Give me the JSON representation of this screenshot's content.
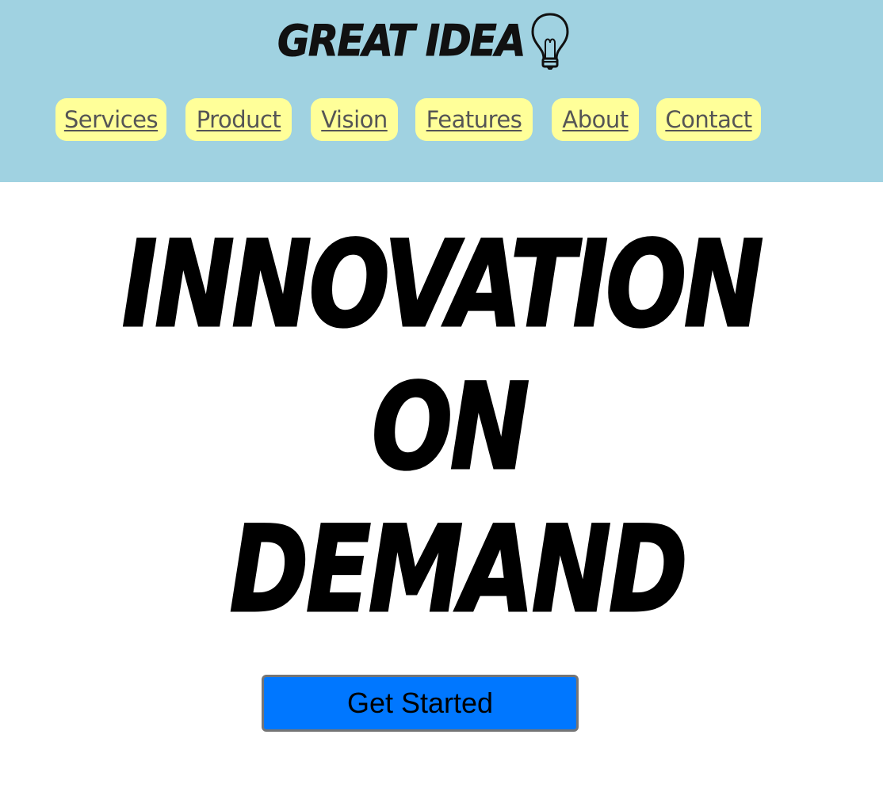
{
  "header": {
    "logo_text": "GREAT IDEA",
    "logo_icon": "lightbulb-icon",
    "background_color": "#a0d2e1"
  },
  "nav": {
    "background_color": "#ffff99",
    "items": [
      {
        "label": "Services"
      },
      {
        "label": "Product"
      },
      {
        "label": "Vision"
      },
      {
        "label": "Features"
      },
      {
        "label": "About"
      },
      {
        "label": "Contact"
      }
    ]
  },
  "hero": {
    "line1": "INNOVATION",
    "line2": "ON",
    "line3": "DEMAND"
  },
  "cta": {
    "label": "Get Started",
    "color": "#0077ff"
  }
}
